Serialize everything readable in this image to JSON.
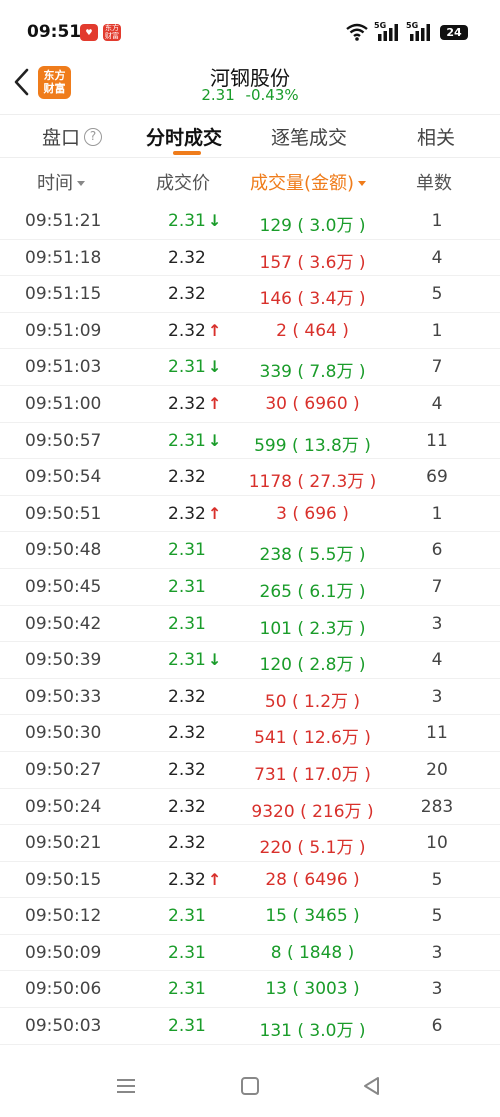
{
  "status": {
    "time": "09:51",
    "icon1": "app-notify-icon",
    "icon2": "finance-app-icon",
    "net1": "5G",
    "net2": "5G",
    "battery": "24"
  },
  "header": {
    "logo_line1": "东方",
    "logo_line2": "财富",
    "stock_name": "河钢股份",
    "price": "2.31",
    "change_pct": "-0.43%"
  },
  "tabs": [
    {
      "label": "盘口"
    },
    {
      "label": "分时成交"
    },
    {
      "label": "逐笔成交"
    },
    {
      "label": "相关"
    }
  ],
  "columns": {
    "time": "时间",
    "price": "成交价",
    "volume": "成交量(金额)",
    "count": "单数"
  },
  "trades": [
    {
      "time": "09:51:21",
      "price": "2.31",
      "dir": "down",
      "vol": "129 ( 3.0万 )",
      "count": "1"
    },
    {
      "time": "09:51:18",
      "price": "2.32",
      "dir": "",
      "vol": "157 ( 3.6万 )",
      "count": "4"
    },
    {
      "time": "09:51:15",
      "price": "2.32",
      "dir": "",
      "vol": "146 ( 3.4万 )",
      "count": "5"
    },
    {
      "time": "09:51:09",
      "price": "2.32",
      "dir": "up",
      "vol": "2 ( 464 )",
      "count": "1"
    },
    {
      "time": "09:51:03",
      "price": "2.31",
      "dir": "down",
      "vol": "339 ( 7.8万 )",
      "count": "7"
    },
    {
      "time": "09:51:00",
      "price": "2.32",
      "dir": "up",
      "vol": "30 ( 6960 )",
      "count": "4"
    },
    {
      "time": "09:50:57",
      "price": "2.31",
      "dir": "down",
      "vol": "599 ( 13.8万 )",
      "count": "11"
    },
    {
      "time": "09:50:54",
      "price": "2.32",
      "dir": "",
      "vol": "1178 ( 27.3万 )",
      "count": "69"
    },
    {
      "time": "09:50:51",
      "price": "2.32",
      "dir": "up",
      "vol": "3 ( 696 )",
      "count": "1"
    },
    {
      "time": "09:50:48",
      "price": "2.31",
      "dir": "",
      "vol": "238 ( 5.5万 )",
      "count": "6"
    },
    {
      "time": "09:50:45",
      "price": "2.31",
      "dir": "",
      "vol": "265 ( 6.1万 )",
      "count": "7"
    },
    {
      "time": "09:50:42",
      "price": "2.31",
      "dir": "",
      "vol": "101 ( 2.3万 )",
      "count": "3"
    },
    {
      "time": "09:50:39",
      "price": "2.31",
      "dir": "down",
      "vol": "120 ( 2.8万 )",
      "count": "4"
    },
    {
      "time": "09:50:33",
      "price": "2.32",
      "dir": "",
      "vol": "50 ( 1.2万 )",
      "count": "3"
    },
    {
      "time": "09:50:30",
      "price": "2.32",
      "dir": "",
      "vol": "541 ( 12.6万 )",
      "count": "11"
    },
    {
      "time": "09:50:27",
      "price": "2.32",
      "dir": "",
      "vol": "731 ( 17.0万 )",
      "count": "20"
    },
    {
      "time": "09:50:24",
      "price": "2.32",
      "dir": "",
      "vol": "9320 ( 216万 )",
      "count": "283"
    },
    {
      "time": "09:50:21",
      "price": "2.32",
      "dir": "",
      "vol": "220 ( 5.1万 )",
      "count": "10"
    },
    {
      "time": "09:50:15",
      "price": "2.32",
      "dir": "up",
      "vol": "28 ( 6496 )",
      "count": "5"
    },
    {
      "time": "09:50:12",
      "price": "2.31",
      "dir": "",
      "vol": "15 ( 3465 )",
      "count": "5"
    },
    {
      "time": "09:50:09",
      "price": "2.31",
      "dir": "",
      "vol": "8 ( 1848 )",
      "count": "3"
    },
    {
      "time": "09:50:06",
      "price": "2.31",
      "dir": "",
      "vol": "13 ( 3003 )",
      "count": "3"
    },
    {
      "time": "09:50:03",
      "price": "2.31",
      "dir": "",
      "vol": "131 ( 3.0万 )",
      "count": "6"
    }
  ],
  "colors": {
    "green": "#1a9c2a",
    "red": "#d8302b",
    "accent": "#ef7c1b"
  },
  "navbar": {
    "icons": [
      "menu-icon",
      "home-icon",
      "back-triangle-icon"
    ]
  }
}
